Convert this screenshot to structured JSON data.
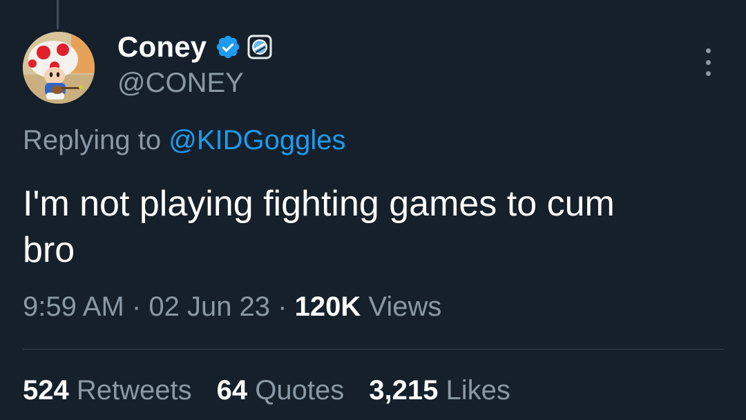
{
  "author": {
    "display_name": "Coney",
    "handle": "@CONEY",
    "verified_icon": "verified-badge-icon",
    "affiliate_icon": "affiliate-badge-icon"
  },
  "reply": {
    "prefix": "Replying to",
    "mention": "@KIDGoggles"
  },
  "tweet": {
    "text": "I'm not playing fighting games to cum\nbro"
  },
  "meta": {
    "time": "9:59 AM",
    "separator": "·",
    "date": "02 Jun 23",
    "views_count": "120K",
    "views_label": "Views"
  },
  "stats": {
    "retweets_count": "524",
    "retweets_label": "Retweets",
    "quotes_count": "64",
    "quotes_label": "Quotes",
    "likes_count": "3,215",
    "likes_label": "Likes"
  },
  "colors": {
    "background": "#15202b",
    "accent": "#1d9bf0",
    "secondary_text": "#8b98a5",
    "primary_text": "#ffffff",
    "divider": "#38444d"
  }
}
